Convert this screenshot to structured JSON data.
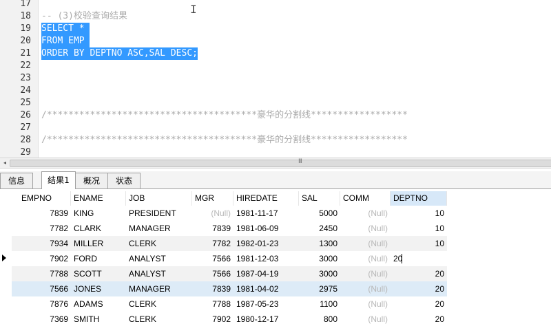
{
  "editor": {
    "lines": [
      {
        "num": "17",
        "text": "",
        "kind": ""
      },
      {
        "num": "18",
        "text": "-- (3)校验查询结果",
        "kind": "cmt"
      },
      {
        "num": "19",
        "text": "SELECT * ",
        "kind": "sel"
      },
      {
        "num": "20",
        "text": "FROM EMP ",
        "kind": "sel"
      },
      {
        "num": "21",
        "text": "ORDER BY DEPTNO ASC,SAL DESC;",
        "kind": "sel"
      },
      {
        "num": "22",
        "text": "",
        "kind": ""
      },
      {
        "num": "23",
        "text": "",
        "kind": ""
      },
      {
        "num": "24",
        "text": "",
        "kind": ""
      },
      {
        "num": "25",
        "text": "",
        "kind": ""
      },
      {
        "num": "26",
        "text": "/***************************************豪华的分割线******************",
        "kind": "cmt"
      },
      {
        "num": "27",
        "text": "",
        "kind": ""
      },
      {
        "num": "28",
        "text": "/***************************************豪华的分割线******************",
        "kind": "cmt"
      },
      {
        "num": "29",
        "text": "",
        "kind": ""
      }
    ],
    "cursor_glyph": "I"
  },
  "scrollbar": {
    "left_arrow": "◂",
    "grip": "III"
  },
  "tabs": [
    {
      "label": "信息",
      "active": false
    },
    {
      "label": "结果1",
      "active": true
    },
    {
      "label": "概况",
      "active": false
    },
    {
      "label": "状态",
      "active": false
    }
  ],
  "grid": {
    "columns": [
      "EMPNO",
      "ENAME",
      "JOB",
      "MGR",
      "HIREDATE",
      "SAL",
      "COMM",
      "DEPTNO"
    ],
    "rows": [
      [
        "7839",
        "KING",
        "PRESIDENT",
        "(Null)",
        "1981-11-17",
        "5000",
        "(Null)",
        "10"
      ],
      [
        "7782",
        "CLARK",
        "MANAGER",
        "7839",
        "1981-06-09",
        "2450",
        "(Null)",
        "10"
      ],
      [
        "7934",
        "MILLER",
        "CLERK",
        "7782",
        "1982-01-23",
        "1300",
        "(Null)",
        "10"
      ],
      [
        "7902",
        "FORD",
        "ANALYST",
        "7566",
        "1981-12-03",
        "3000",
        "(Null)",
        "20"
      ],
      [
        "7788",
        "SCOTT",
        "ANALYST",
        "7566",
        "1987-04-19",
        "3000",
        "(Null)",
        "20"
      ],
      [
        "7566",
        "JONES",
        "MANAGER",
        "7839",
        "1981-04-02",
        "2975",
        "(Null)",
        "20"
      ],
      [
        "7876",
        "ADAMS",
        "CLERK",
        "7788",
        "1987-05-23",
        "1100",
        "(Null)",
        "20"
      ],
      [
        "7369",
        "SMITH",
        "CLERK",
        "7902",
        "1980-12-17",
        "800",
        "(Null)",
        "20"
      ]
    ],
    "current_row": 3,
    "editing_column": "DEPTNO",
    "highlight_color": "#d7e8f8"
  },
  "colors": {
    "selection": "#3399ff",
    "comment": "#aaaaaa",
    "null_text": "#b8b8b8"
  }
}
